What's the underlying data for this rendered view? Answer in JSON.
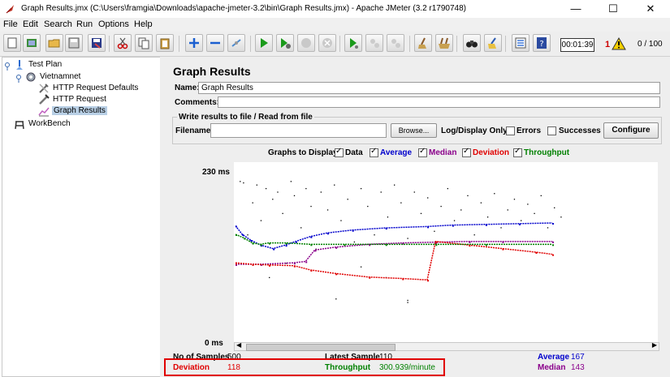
{
  "window": {
    "title": "Graph Results.jmx (C:\\Users\\framgia\\Downloads\\apache-jmeter-3.2\\bin\\Graph Results.jmx) - Apache JMeter (3.2 r1790748)",
    "minimize": "—",
    "maximize": "☐",
    "close": "✕"
  },
  "menu": [
    "File",
    "Edit",
    "Search",
    "Run",
    "Options",
    "Help"
  ],
  "toolbar": {
    "timer": "00:01:39",
    "warning_count": "1",
    "threads": "0 / 100"
  },
  "tree": {
    "test_plan": "Test Plan",
    "thread_group": "Vietnamnet",
    "http_defaults": "HTTP Request Defaults",
    "http_request": "HTTP Request",
    "graph_results": "Graph Results",
    "workbench": "WorkBench"
  },
  "panel": {
    "title": "Graph Results",
    "name_label": "Name:",
    "name_value": "Graph Results",
    "comments_label": "Comments:",
    "comments_value": "",
    "file_group": "Write results to file / Read from file",
    "filename_label": "Filename",
    "filename_value": "",
    "browse": "Browse...",
    "log_display": "Log/Display Only:",
    "errors": "Errors",
    "successes": "Successes",
    "configure": "Configure"
  },
  "graphs_to_display": {
    "label": "Graphs to Display",
    "options": [
      {
        "name": "Data",
        "color": "#000000",
        "checked": true
      },
      {
        "name": "Average",
        "color": "#0000cc",
        "checked": true
      },
      {
        "name": "Median",
        "color": "#8a008a",
        "checked": true
      },
      {
        "name": "Deviation",
        "color": "#e00000",
        "checked": true
      },
      {
        "name": "Throughput",
        "color": "#008000",
        "checked": true
      }
    ]
  },
  "graph": {
    "y_max_label": "230  ms",
    "y_min_label": "0  ms"
  },
  "stats": {
    "no_samples_label": "No of Samples",
    "no_samples_value": "500",
    "latest_sample_label": "Latest Sample",
    "latest_sample_value": "110",
    "average_label": "Average",
    "average_value": "167",
    "deviation_label": "Deviation",
    "deviation_value": "118",
    "throughput_label": "Throughput",
    "throughput_value": "300.939/minute",
    "median_label": "Median",
    "median_value": "143"
  },
  "chart_data": {
    "type": "scatter",
    "ylim": [
      0,
      230
    ],
    "series": [
      {
        "name": "Data",
        "color": "#000000",
        "points": [
          [
            5,
            215
          ],
          [
            9,
            213
          ],
          [
            14,
            140
          ],
          [
            20,
            185
          ],
          [
            25,
            210
          ],
          [
            30,
            160
          ],
          [
            36,
            205
          ],
          [
            40,
            80
          ],
          [
            44,
            190
          ],
          [
            50,
            200
          ],
          [
            56,
            170
          ],
          [
            60,
            100
          ],
          [
            66,
            215
          ],
          [
            70,
            195
          ],
          [
            78,
            150
          ],
          [
            84,
            205
          ],
          [
            90,
            180
          ],
          [
            96,
            120
          ],
          [
            102,
            200
          ],
          [
            110,
            175
          ],
          [
            118,
            210
          ],
          [
            126,
            160
          ],
          [
            134,
            190
          ],
          [
            142,
            130
          ],
          [
            150,
            205
          ],
          [
            158,
            180
          ],
          [
            166,
            140
          ],
          [
            174,
            200
          ],
          [
            182,
            165
          ],
          [
            190,
            210
          ],
          [
            198,
            185
          ],
          [
            206,
            135
          ],
          [
            214,
            200
          ],
          [
            222,
            170
          ],
          [
            230,
            192
          ],
          [
            238,
            145
          ],
          [
            246,
            180
          ],
          [
            254,
            205
          ],
          [
            262,
            160
          ],
          [
            270,
            175
          ],
          [
            278,
            195
          ],
          [
            286,
            140
          ],
          [
            294,
            185
          ],
          [
            302,
            165
          ],
          [
            310,
            198
          ],
          [
            318,
            150
          ],
          [
            326,
            175
          ],
          [
            334,
            190
          ],
          [
            342,
            160
          ],
          [
            350,
            183
          ],
          [
            358,
            170
          ],
          [
            366,
            195
          ],
          [
            374,
            150
          ],
          [
            382,
            178
          ],
          [
            390,
            165
          ],
          [
            206,
            48
          ],
          [
            206,
            45
          ],
          [
            120,
            50
          ],
          [
            150,
            95
          ],
          [
            180,
            80
          ]
        ]
      },
      {
        "name": "Average",
        "color": "#0000cc",
        "points": [
          [
            0,
            152
          ],
          [
            8,
            140
          ],
          [
            18,
            132
          ],
          [
            30,
            125
          ],
          [
            45,
            120
          ],
          [
            60,
            125
          ],
          [
            72,
            130
          ],
          [
            90,
            137
          ],
          [
            110,
            142
          ],
          [
            140,
            146
          ],
          [
            180,
            149
          ],
          [
            230,
            151
          ],
          [
            260,
            153
          ],
          [
            300,
            154
          ],
          [
            340,
            155
          ],
          [
            380,
            156
          ]
        ]
      },
      {
        "name": "Median",
        "color": "#8a008a",
        "points": [
          [
            0,
            98
          ],
          [
            30,
            98
          ],
          [
            70,
            100
          ],
          [
            84,
            102
          ],
          [
            95,
            118
          ],
          [
            120,
            122
          ],
          [
            160,
            126
          ],
          [
            200,
            128
          ],
          [
            240,
            129
          ],
          [
            280,
            130
          ],
          [
            320,
            130
          ],
          [
            380,
            130
          ]
        ]
      },
      {
        "name": "Deviation",
        "color": "#e00000",
        "points": [
          [
            0,
            100
          ],
          [
            20,
            98
          ],
          [
            40,
            97
          ],
          [
            70,
            96
          ],
          [
            90,
            90
          ],
          [
            120,
            85
          ],
          [
            160,
            80
          ],
          [
            200,
            78
          ],
          [
            230,
            76
          ],
          [
            240,
            130
          ],
          [
            280,
            125
          ],
          [
            320,
            120
          ],
          [
            360,
            115
          ],
          [
            380,
            112
          ]
        ]
      },
      {
        "name": "Throughput",
        "color": "#008000",
        "points": [
          [
            0,
            140
          ],
          [
            10,
            135
          ],
          [
            20,
            128
          ],
          [
            30,
            126
          ],
          [
            40,
            128
          ],
          [
            60,
            128
          ],
          [
            90,
            126
          ],
          [
            130,
            126
          ],
          [
            180,
            126
          ],
          [
            240,
            126
          ],
          [
            300,
            126
          ],
          [
            380,
            126
          ]
        ]
      }
    ]
  }
}
